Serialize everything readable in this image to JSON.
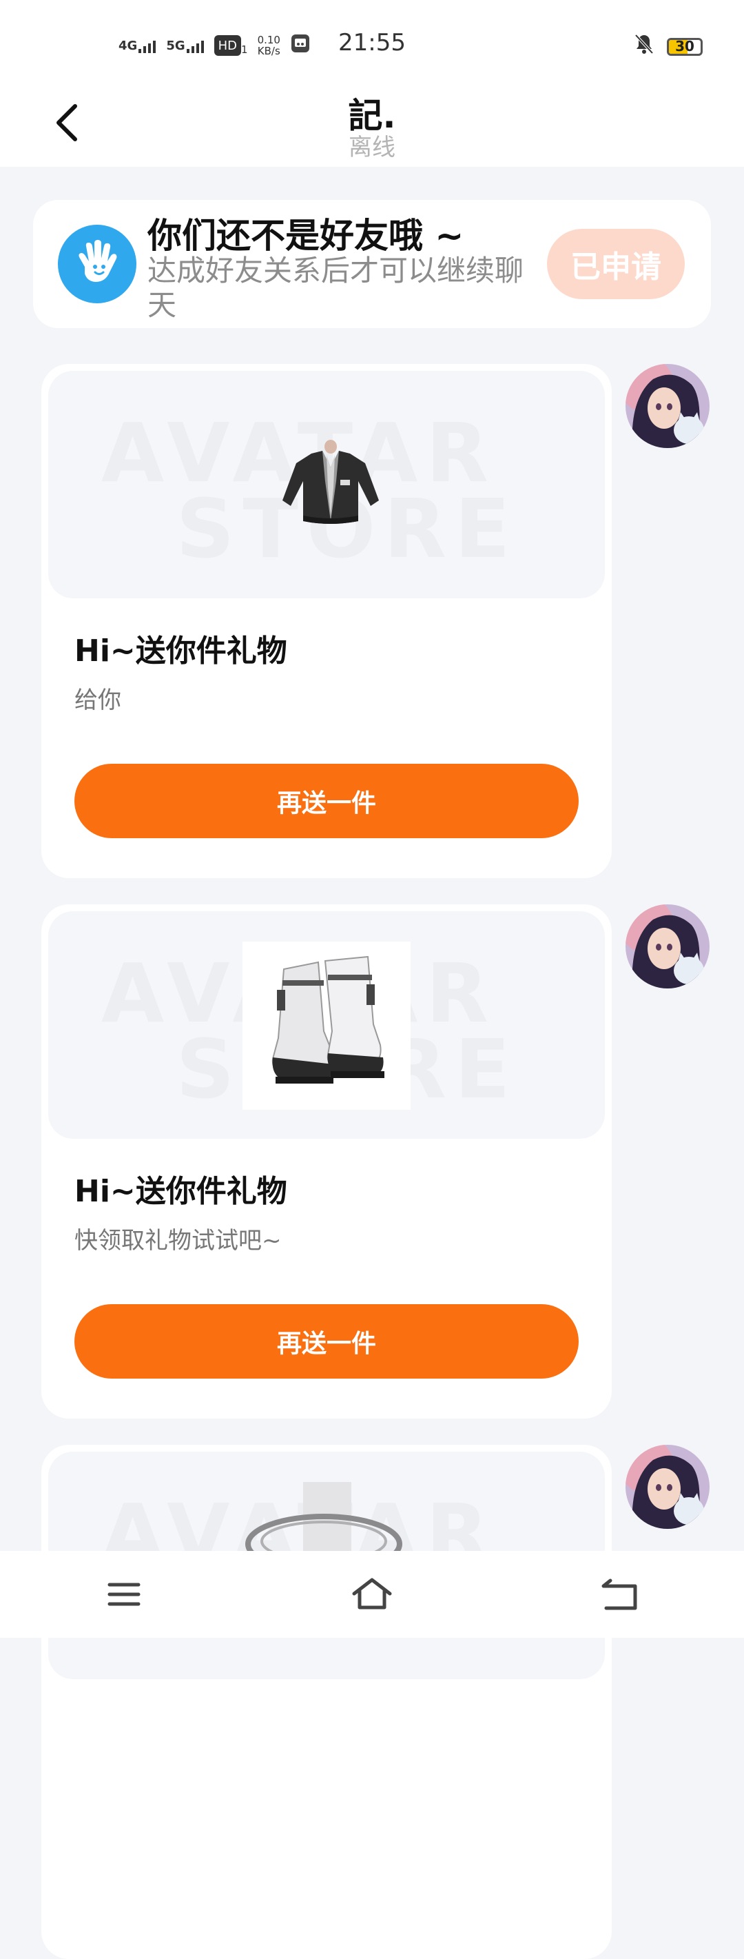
{
  "status_bar": {
    "network1": "4G",
    "network2": "5G",
    "hd": "HD",
    "hd_sub": "1",
    "speed_value": "0.10",
    "speed_unit": "KB/s",
    "time": "21:55",
    "battery": "30"
  },
  "header": {
    "title": "記.",
    "subtitle": "离线"
  },
  "friend_notice": {
    "title": "你们还不是好友哦 ~",
    "description": "达成好友关系后才可以继续聊天",
    "button_label": "已申请"
  },
  "watermark": {
    "line1": "AVATAR",
    "line2": "STORE"
  },
  "messages": [
    {
      "gift_title": "Hi~送你件礼物",
      "gift_message": "给你",
      "button_label": "再送一件",
      "item_icon": "jacket-icon"
    },
    {
      "gift_title": "Hi~送你件礼物",
      "gift_message": "快领取礼物试试吧~",
      "button_label": "再送一件",
      "item_icon": "boots-icon"
    }
  ],
  "colors": {
    "accent": "#fa7011",
    "applied_button": "#fdd9cc",
    "hand_avatar": "#2fa8ee",
    "page_bg": "#f3f5f8"
  }
}
